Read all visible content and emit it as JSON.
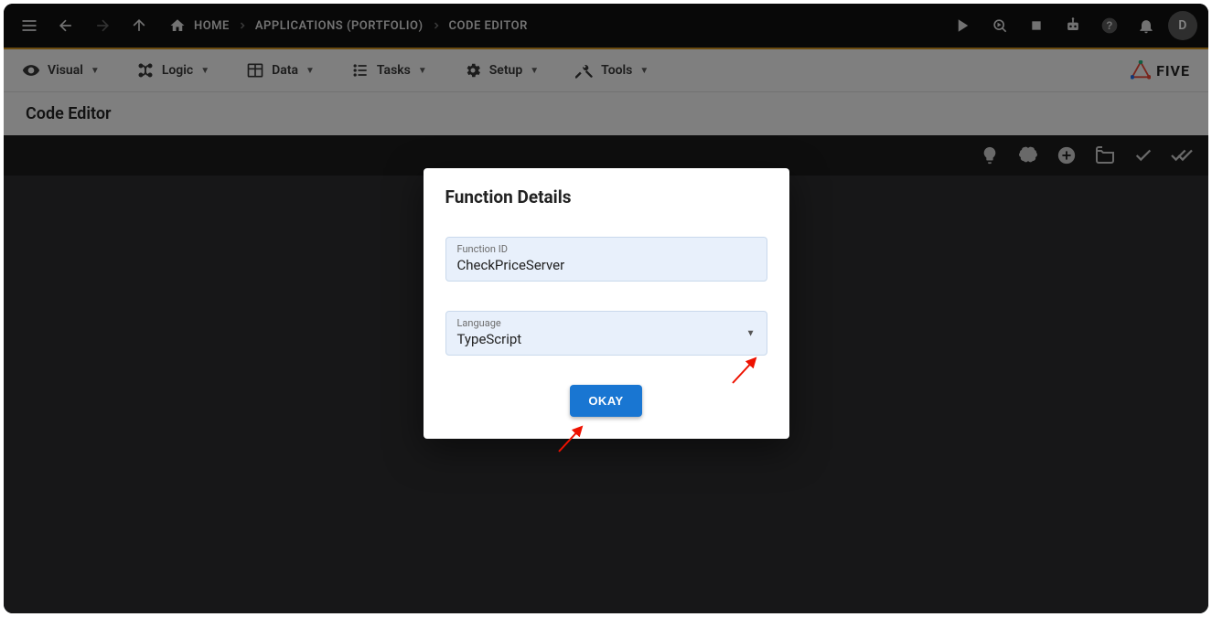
{
  "topbar": {
    "breadcrumbs": [
      "HOME",
      "APPLICATIONS (PORTFOLIO)",
      "CODE EDITOR"
    ],
    "avatar_initial": "D"
  },
  "menubar": {
    "items": [
      {
        "label": "Visual"
      },
      {
        "label": "Logic"
      },
      {
        "label": "Data"
      },
      {
        "label": "Tasks"
      },
      {
        "label": "Setup"
      },
      {
        "label": "Tools"
      }
    ],
    "brand": "FIVE"
  },
  "section": {
    "title": "Code Editor"
  },
  "dialog": {
    "title": "Function Details",
    "function_id_label": "Function ID",
    "function_id_value": "CheckPriceServer",
    "language_label": "Language",
    "language_value": "TypeScript",
    "okay_label": "OKAY"
  }
}
